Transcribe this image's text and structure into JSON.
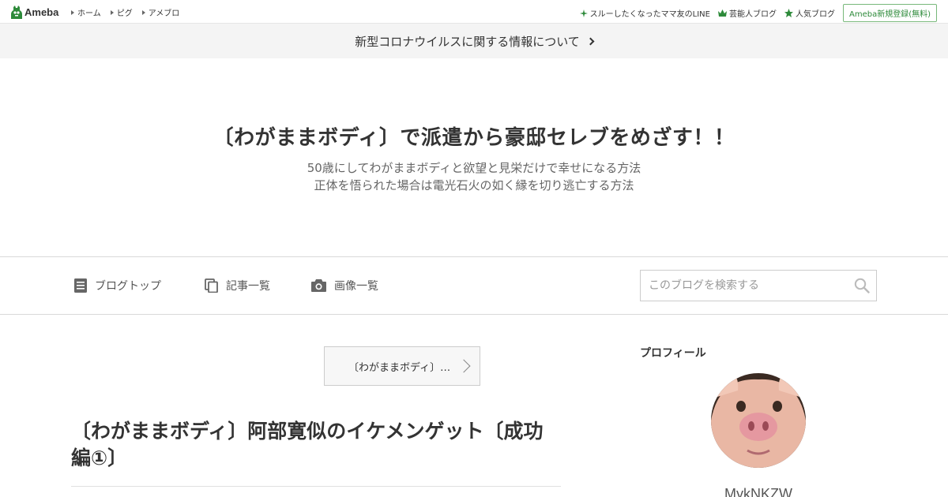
{
  "header": {
    "logo_text": "Ameba",
    "nav": [
      {
        "label": "ホーム"
      },
      {
        "label": "ピグ"
      },
      {
        "label": "アメブロ"
      }
    ],
    "right_links": [
      {
        "label": "スルーしたくなったママ友のLINE",
        "icon": "sparkle-icon"
      },
      {
        "label": "芸能人ブログ",
        "icon": "crown-icon"
      },
      {
        "label": "人気ブログ",
        "icon": "star-icon"
      }
    ],
    "register_label": "Ameba新規登録(無料)",
    "brand_color": "#2d8a3a"
  },
  "notice": {
    "text": "新型コロナウイルスに関する情報について"
  },
  "blog": {
    "title": "〔わがままボディ〕で派遣から豪邸セレブをめざす！！",
    "desc_line1": "50歳にしてわがままボディと欲望と見栄だけで幸せになる方法",
    "desc_line2": "正体を悟られた場合は電光石火の如く縁を切り逃亡する方法"
  },
  "blog_nav": {
    "items": [
      {
        "label": "ブログトップ",
        "icon": "document-icon"
      },
      {
        "label": "記事一覧",
        "icon": "copy-icon"
      },
      {
        "label": "画像一覧",
        "icon": "camera-icon"
      }
    ],
    "search_placeholder": "このブログを検索する"
  },
  "main": {
    "theme_button": "〔わがままボディ〕…",
    "entry_title": "〔わがままボディ〕阿部寛似のイケメンゲット〔成功編①〕"
  },
  "sidebar": {
    "heading": "プロフィール",
    "username": "MykNKZW"
  }
}
